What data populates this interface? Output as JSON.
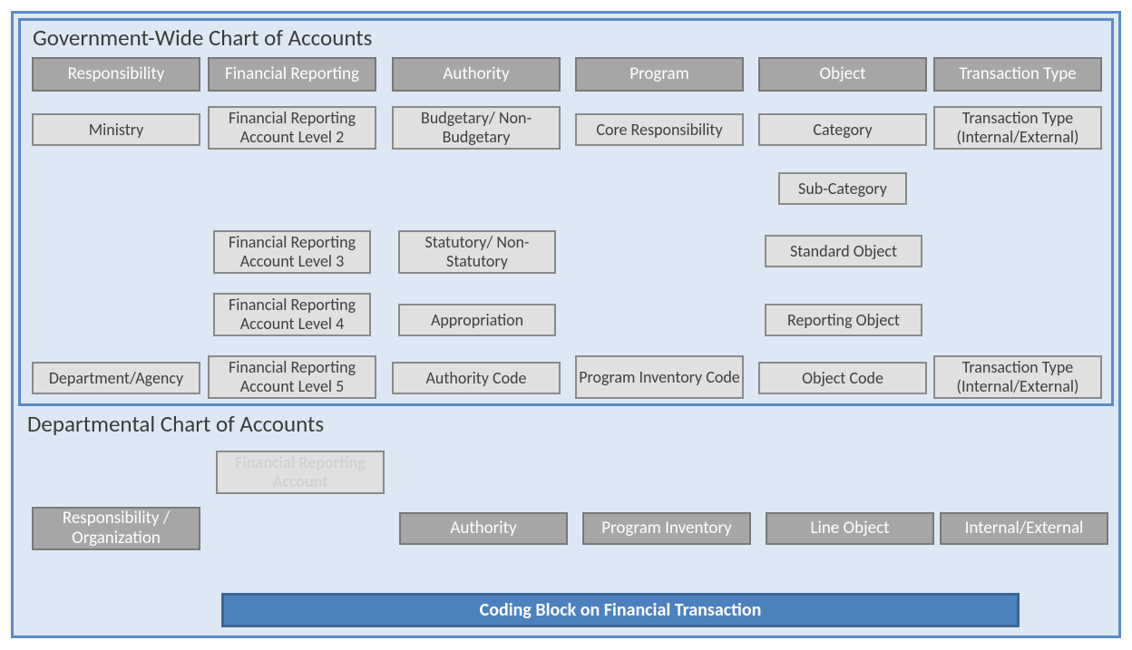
{
  "titles": {
    "gw": "Government-Wide Chart of Accounts",
    "dep": "Departmental Chart of Accounts"
  },
  "columns": {
    "responsibility": {
      "header": "Responsibility",
      "top": "Ministry",
      "bottom": "Department/Agency"
    },
    "financial": {
      "header": "Financial Reporting",
      "l2": "Financial Reporting Account Level 2",
      "l3": "Financial Reporting Account Level 3",
      "l4": "Financial Reporting Account Level 4",
      "l5": "Financial Reporting Account Level 5"
    },
    "authority": {
      "header": "Authority",
      "budgetary": "Budgetary/ Non-Budgetary",
      "statutory": "Statutory/ Non-Statutory",
      "appropriation": "Appropriation",
      "code": "Authority Code"
    },
    "program": {
      "header": "Program",
      "core": "Core Responsibility",
      "inv": "Program Inventory Code"
    },
    "object": {
      "header": "Object",
      "category": "Category",
      "sub": "Sub-Category",
      "standard": "Standard Object",
      "reporting": "Reporting Object",
      "code": "Object Code"
    },
    "trans": {
      "header": "Transaction Type",
      "top": "Transaction Type (Internal/External)",
      "bottom": "Transaction Type (Internal/External)"
    }
  },
  "departmental": {
    "fra": "Financial Reporting Account",
    "resp": "Responsibility / Organization",
    "authority": "Authority",
    "program": "Program Inventory",
    "line": "Line Object",
    "ie": "Internal/External",
    "coding": "Coding Block on Financial Transaction"
  }
}
